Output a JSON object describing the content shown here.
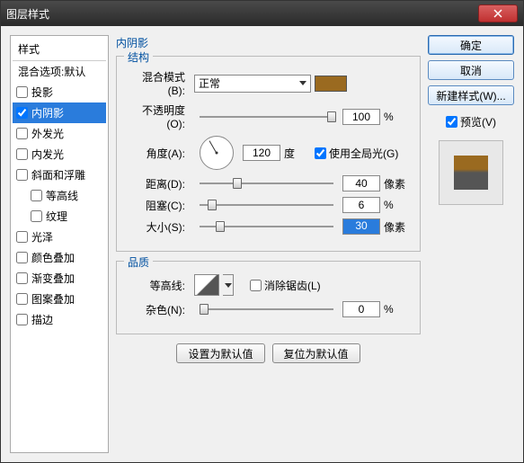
{
  "window": {
    "title": "图层样式"
  },
  "left": {
    "header": "样式",
    "subheader": "混合选项:默认",
    "items": [
      {
        "label": "投影",
        "checked": false,
        "selected": false
      },
      {
        "label": "内阴影",
        "checked": true,
        "selected": true
      },
      {
        "label": "外发光",
        "checked": false,
        "selected": false
      },
      {
        "label": "内发光",
        "checked": false,
        "selected": false
      },
      {
        "label": "斜面和浮雕",
        "checked": false,
        "selected": false
      },
      {
        "label": "等高线",
        "checked": false,
        "selected": false,
        "indent": true
      },
      {
        "label": "纹理",
        "checked": false,
        "selected": false,
        "indent": true
      },
      {
        "label": "光泽",
        "checked": false,
        "selected": false
      },
      {
        "label": "颜色叠加",
        "checked": false,
        "selected": false
      },
      {
        "label": "渐变叠加",
        "checked": false,
        "selected": false
      },
      {
        "label": "图案叠加",
        "checked": false,
        "selected": false
      },
      {
        "label": "描边",
        "checked": false,
        "selected": false
      }
    ]
  },
  "mid": {
    "title": "内阴影",
    "structure": {
      "legend": "结构",
      "blend_label": "混合模式(B):",
      "blend_value": "正常",
      "swatch_color": "#9a6a20",
      "opacity_label": "不透明度(O):",
      "opacity_value": "100",
      "opacity_unit": "%",
      "angle_label": "角度(A):",
      "angle_value": "120",
      "angle_unit": "度",
      "global_light_label": "使用全局光(G)",
      "global_light_checked": true,
      "distance_label": "距离(D):",
      "distance_value": "40",
      "distance_unit": "像素",
      "choke_label": "阻塞(C):",
      "choke_value": "6",
      "choke_unit": "%",
      "size_label": "大小(S):",
      "size_value": "30",
      "size_unit": "像素"
    },
    "quality": {
      "legend": "品质",
      "contour_label": "等高线:",
      "antialias_label": "消除锯齿(L)",
      "antialias_checked": false,
      "noise_label": "杂色(N):",
      "noise_value": "0",
      "noise_unit": "%"
    },
    "buttons": {
      "make_default": "设置为默认值",
      "reset_default": "复位为默认值"
    }
  },
  "right": {
    "ok": "确定",
    "cancel": "取消",
    "new_style": "新建样式(W)...",
    "preview_label": "预览(V)",
    "preview_checked": true
  }
}
